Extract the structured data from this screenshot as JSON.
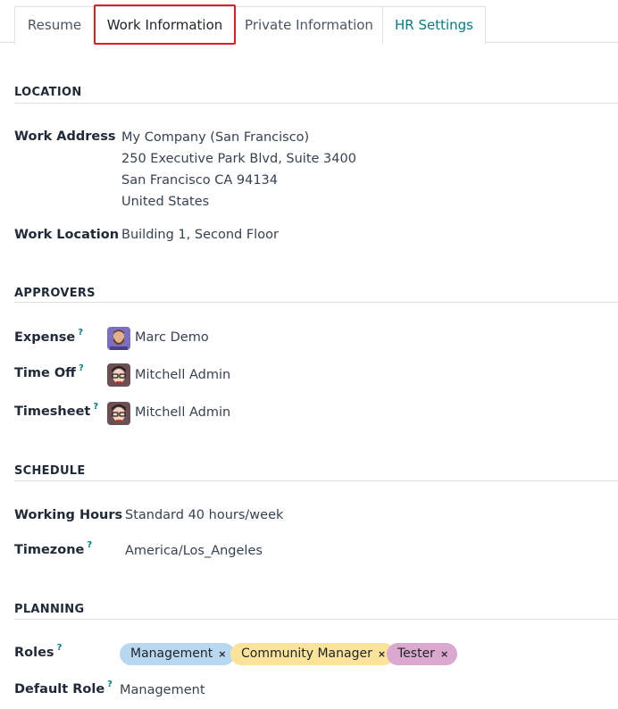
{
  "tabs": [
    {
      "label": "Resume"
    },
    {
      "label": "Work Information"
    },
    {
      "label": "Private Information"
    },
    {
      "label": "HR Settings"
    }
  ],
  "location": {
    "title": "LOCATION",
    "work_address_label": "Work Address",
    "work_address_lines": [
      "My Company (San Francisco)",
      "250 Executive Park Blvd, Suite 3400",
      "San Francisco CA 94134",
      "United States"
    ],
    "work_location_label": "Work Location",
    "work_location_value": "Building 1, Second Floor"
  },
  "approvers": {
    "title": "APPROVERS",
    "expense_label": "Expense",
    "expense_value": "Marc Demo",
    "time_off_label": "Time Off",
    "time_off_value": "Mitchell Admin",
    "timesheet_label": "Timesheet",
    "timesheet_value": "Mitchell Admin",
    "help_mark": "?"
  },
  "schedule": {
    "title": "SCHEDULE",
    "working_hours_label": "Working Hours",
    "working_hours_value": "Standard 40 hours/week",
    "timezone_label": "Timezone",
    "timezone_value": "America/Los_Angeles"
  },
  "planning": {
    "title": "PLANNING",
    "roles_label": "Roles",
    "roles": [
      {
        "label": "Management",
        "color": "#b8d8f2"
      },
      {
        "label": "Community Manager",
        "color": "#fbe39a"
      },
      {
        "label": "Tester",
        "color": "#dba8cf"
      }
    ],
    "remove_mark": "×",
    "default_role_label": "Default Role",
    "default_role_value": "Management"
  },
  "colors": {
    "accent": "#017e84",
    "highlight": "#e31b1b"
  },
  "icons": {
    "expense_avatar": "avatar-bearded-man-icon",
    "admin_avatar": "avatar-admin-glasses-icon"
  }
}
